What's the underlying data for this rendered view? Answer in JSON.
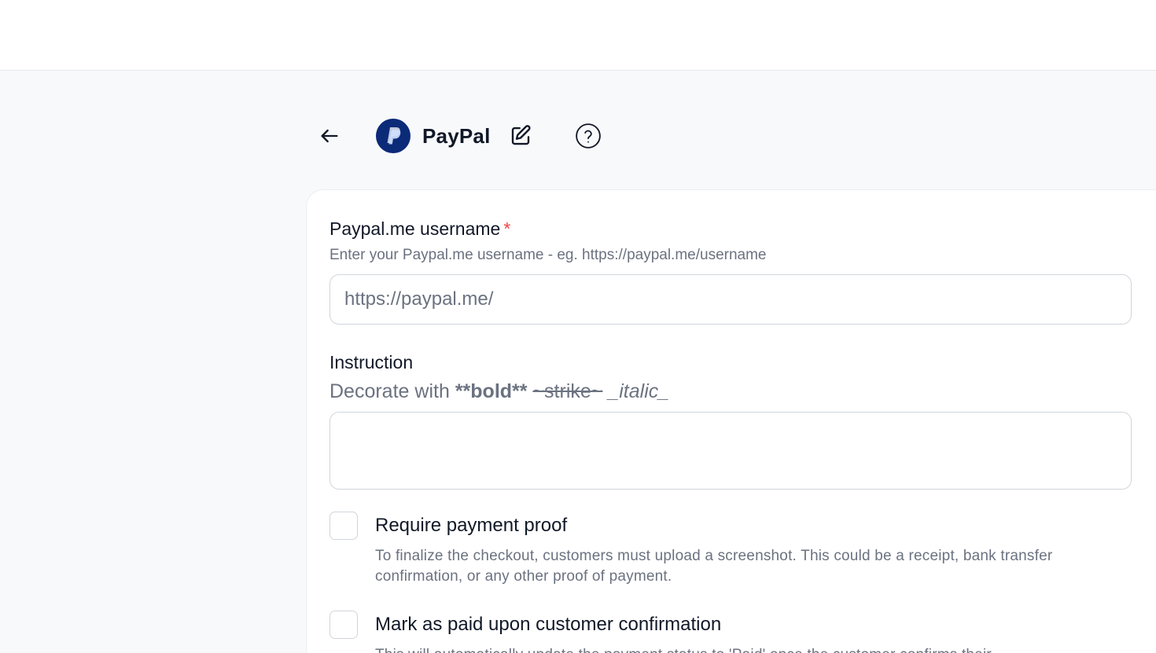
{
  "header": {
    "title": "PayPal",
    "back_icon": "arrow-left-icon",
    "logo_icon": "paypal-logo-icon",
    "edit_icon": "edit-icon",
    "help_icon": "help-circle-icon",
    "logo_color": "#0b2a78"
  },
  "form": {
    "username": {
      "label": "Paypal.me username",
      "required_mark": "*",
      "help": "Enter your Paypal.me username - eg. https://paypal.me/username",
      "placeholder": "https://paypal.me/",
      "value": ""
    },
    "instruction": {
      "label": "Instruction",
      "help_prefix": "Decorate with",
      "help_bold": "**bold**",
      "help_strike": "~strike~",
      "help_italic": "_italic_",
      "value": ""
    },
    "require_proof": {
      "label": "Require payment proof",
      "description": "To finalize the checkout, customers must upload a screenshot. This could be a receipt, bank transfer confirmation, or any other proof of payment.",
      "checked": false
    },
    "mark_paid": {
      "label": "Mark as paid upon customer confirmation",
      "description": "This will automatically update the payment status to 'Paid' once the customer confirms their",
      "checked": false
    }
  },
  "colors": {
    "background": "#f8f9fb",
    "required": "#ef4444",
    "muted_text": "#6b7280"
  }
}
